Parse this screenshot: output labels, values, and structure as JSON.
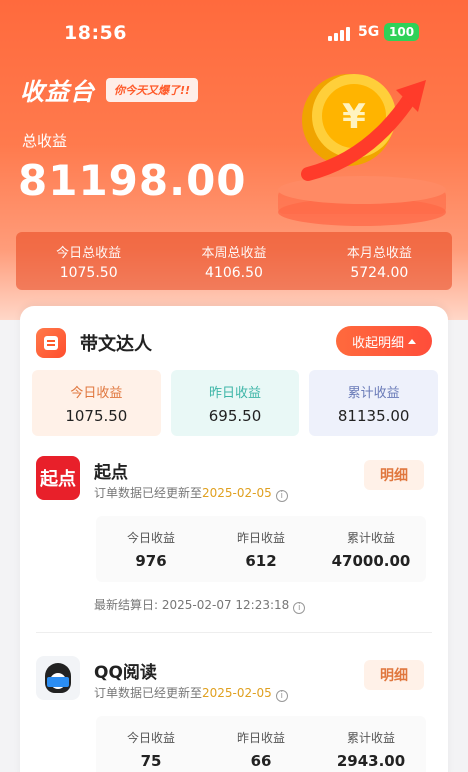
{
  "status_bar": {
    "time": "18:56",
    "network": "5G",
    "battery": "100"
  },
  "header": {
    "brand": "收益台",
    "slogan": "你今天又爆了!!",
    "total_label": "总收益",
    "total_value": "81198.00"
  },
  "periods": [
    {
      "label": "今日总收益",
      "value": "1075.50"
    },
    {
      "label": "本周总收益",
      "value": "4106.50"
    },
    {
      "label": "本月总收益",
      "value": "5724.00"
    }
  ],
  "section": {
    "title": "带文达人",
    "collapse_label": "收起明细",
    "summary": [
      {
        "label": "今日收益",
        "value": "1075.50"
      },
      {
        "label": "昨日收益",
        "value": "695.50"
      },
      {
        "label": "累计收益",
        "value": "81135.00"
      }
    ]
  },
  "platforms": [
    {
      "logo_text": "起点",
      "name": "起点",
      "update_prefix": "订单数据已经更新至",
      "update_date": "2025-02-05",
      "detail_label": "明细",
      "stats": [
        {
          "label": "今日收益",
          "value": "976"
        },
        {
          "label": "昨日收益",
          "value": "612"
        },
        {
          "label": "累计收益",
          "value": "47000.00"
        }
      ],
      "settle_text": "最新结算日: 2025-02-07 12:23:18"
    },
    {
      "name": "QQ阅读",
      "update_prefix": "订单数据已经更新至",
      "update_date": "2025-02-05",
      "detail_label": "明细",
      "stats": [
        {
          "label": "今日收益",
          "value": "75"
        },
        {
          "label": "昨日收益",
          "value": "66"
        },
        {
          "label": "累计收益",
          "value": "2943.00"
        }
      ]
    }
  ]
}
